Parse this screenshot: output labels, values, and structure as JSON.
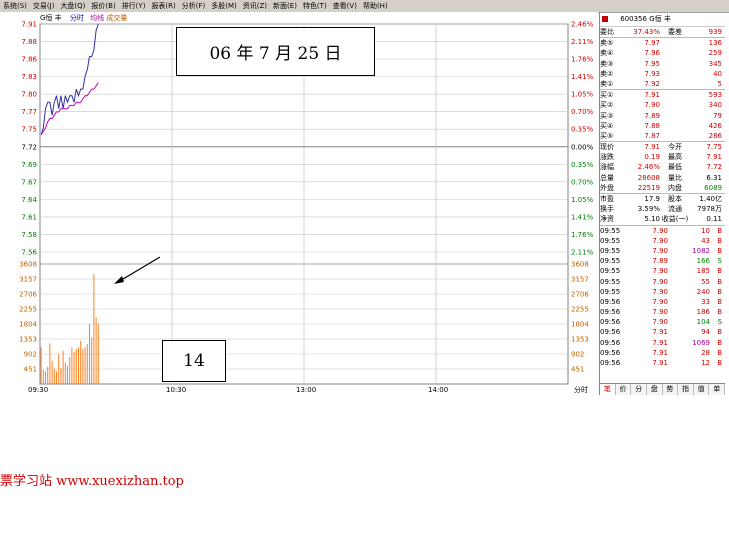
{
  "menu": [
    "系统(S)",
    "交易(J)",
    "大盘(Q)",
    "报价(B)",
    "排行(Y)",
    "报表(R)",
    "分析(F)",
    "多股(M)",
    "资讯(Z)",
    "新面(E)",
    "特色(T)",
    "查看(V)",
    "帮助(H)"
  ],
  "chart_header": {
    "name": "G恒 丰",
    "tab": "分时",
    "avg": "均线",
    "vol": "成交量"
  },
  "price_axis": [
    "7.91",
    "7.88",
    "7.86",
    "7.83",
    "7.80",
    "7.77",
    "7.75",
    "7.72",
    "7.69",
    "7.67",
    "7.64",
    "7.61",
    "7.58",
    "7.56"
  ],
  "pct_axis": [
    "2.46%",
    "2.11%",
    "1.76%",
    "1.41%",
    "1.05%",
    "0.70%",
    "0.35%",
    "0.00%",
    "0.35%",
    "0.70%",
    "1.05%",
    "1.41%",
    "1.76%",
    "2.11%"
  ],
  "volume_axis": [
    "3608",
    "3157",
    "2706",
    "2255",
    "1804",
    "1353",
    "902",
    "451"
  ],
  "time_labels": [
    "09:30",
    "10:30",
    "13:00",
    "14:00"
  ],
  "time_corner": "分时",
  "annotations": {
    "date": "06 年 7 月 25 日",
    "count": "14"
  },
  "watermark": "票学习站   www.xuexizhan.top",
  "colors": {
    "up": "#d00000",
    "down": "#008000",
    "price_line": "#3030a0",
    "avg_line": "#c000c0",
    "volume": "#ff8020",
    "grid": "#c8c8c8"
  },
  "chart_data": {
    "type": "line",
    "x": [
      "09:30",
      "09:31",
      "09:32",
      "09:33",
      "09:34",
      "09:35",
      "09:36",
      "09:37",
      "09:38",
      "09:39",
      "09:40",
      "09:41",
      "09:42",
      "09:43",
      "09:44",
      "09:45",
      "09:46",
      "09:47",
      "09:48",
      "09:49",
      "09:50",
      "09:51",
      "09:52",
      "09:53",
      "09:54",
      "09:55",
      "09:56"
    ],
    "series": [
      {
        "values": [
          7.74,
          7.75,
          7.78,
          7.79,
          7.79,
          7.77,
          7.79,
          7.8,
          7.78,
          7.8,
          7.78,
          7.8,
          7.79,
          7.8,
          7.8,
          7.79,
          7.81,
          7.8,
          7.81,
          7.81,
          7.83,
          7.84,
          7.86,
          7.86,
          7.87,
          7.9,
          7.91
        ]
      },
      {
        "values": [
          7.74,
          7.745,
          7.75,
          7.76,
          7.765,
          7.765,
          7.77,
          7.775,
          7.775,
          7.78,
          7.78,
          7.78,
          7.78,
          7.785,
          7.785,
          7.785,
          7.79,
          7.79,
          7.79,
          7.795,
          7.8,
          7.8,
          7.805,
          7.81,
          7.81,
          7.815,
          7.82
        ]
      }
    ],
    "volume": [
      1100,
      420,
      380,
      520,
      1220,
      700,
      460,
      380,
      900,
      480,
      1000,
      640,
      540,
      820,
      1100,
      960,
      1050,
      1100,
      1300,
      1050,
      1100,
      1200,
      1800,
      1400,
      3300,
      2000,
      1800
    ],
    "ylim": [
      7.56,
      7.91
    ],
    "volume_ylim": [
      0,
      3608
    ]
  },
  "quote": {
    "code": "600356",
    "name": "G恒 丰",
    "weibi_label": "委比",
    "weibi": "37.43%",
    "weicha_label": "委差",
    "weicha": "939",
    "sell": [
      {
        "label": "卖⑤",
        "price": "7.97",
        "vol": "136"
      },
      {
        "label": "卖④",
        "price": "7.96",
        "vol": "259"
      },
      {
        "label": "卖③",
        "price": "7.95",
        "vol": "345"
      },
      {
        "label": "卖②",
        "price": "7.93",
        "vol": "40"
      },
      {
        "label": "卖①",
        "price": "7.92",
        "vol": "5"
      }
    ],
    "buy": [
      {
        "label": "买①",
        "price": "7.91",
        "vol": "593"
      },
      {
        "label": "买②",
        "price": "7.90",
        "vol": "340"
      },
      {
        "label": "买③",
        "price": "7.89",
        "vol": "79"
      },
      {
        "label": "买④",
        "price": "7.88",
        "vol": "426"
      },
      {
        "label": "买⑤",
        "price": "7.87",
        "vol": "286"
      }
    ],
    "stats": [
      [
        "现价",
        "7.91",
        "今开",
        "7.75"
      ],
      [
        "涨跌",
        "0.19",
        "最高",
        "7.91"
      ],
      [
        "涨幅",
        "2.46%",
        "最低",
        "7.72"
      ],
      [
        "总量",
        "28608",
        "量比",
        "6.31"
      ],
      [
        "外盘",
        "22519",
        "内盘",
        "6089"
      ]
    ],
    "stats2": [
      [
        "市盈",
        "17.9",
        "股本",
        "1.40亿"
      ],
      [
        "换手",
        "3.59%",
        "流通",
        "7978万"
      ],
      [
        "净资",
        "5.10",
        "收益(一)",
        "0.11"
      ]
    ],
    "ticks": [
      [
        "09:55",
        "7.90",
        "10",
        "B"
      ],
      [
        "09:55",
        "7.90",
        "43",
        "B"
      ],
      [
        "09:55",
        "7.90",
        "1082",
        "B"
      ],
      [
        "09:55",
        "7.89",
        "166",
        "S"
      ],
      [
        "09:55",
        "7.90",
        "185",
        "B"
      ],
      [
        "09:55",
        "7.90",
        "55",
        "B"
      ],
      [
        "09:55",
        "7.90",
        "240",
        "B"
      ],
      [
        "09:56",
        "7.90",
        "33",
        "B"
      ],
      [
        "09:56",
        "7.90",
        "186",
        "B"
      ],
      [
        "09:56",
        "7.90",
        "104",
        "S"
      ],
      [
        "09:56",
        "7.91",
        "94",
        "B"
      ],
      [
        "09:56",
        "7.91",
        "1069",
        "B"
      ],
      [
        "09:56",
        "7.91",
        "28",
        "B"
      ],
      [
        "09:56",
        "7.91",
        "12",
        "B"
      ]
    ],
    "tabs": [
      "笔",
      "价",
      "分",
      "盘",
      "势",
      "指",
      "值",
      "单"
    ]
  }
}
